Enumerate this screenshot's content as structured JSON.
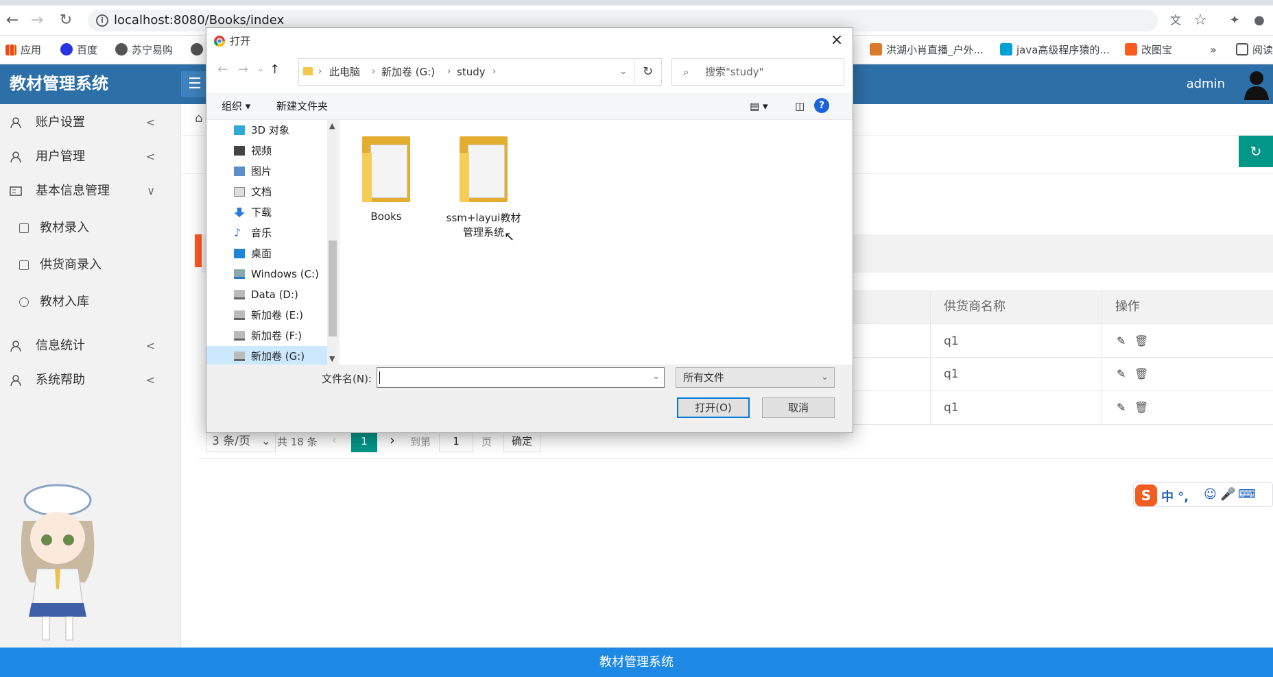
{
  "browser": {
    "url": "localhost:8080/Books/index",
    "bookmarks": [
      "应用",
      "百度",
      "苏宁易购",
      "洪湖小肖直播_户外...",
      "java高级程序猿的...",
      "改图宝",
      "阅读"
    ],
    "more": "»"
  },
  "app": {
    "title": "教材管理系统",
    "user": "admin",
    "footer": "教材管理系统"
  },
  "sidebar": {
    "items": [
      {
        "label": "账户设置",
        "arrow": "<"
      },
      {
        "label": "用户管理",
        "arrow": "<"
      },
      {
        "label": "基本信息管理",
        "arrow": "∨"
      },
      {
        "label": "信息统计",
        "arrow": "<"
      },
      {
        "label": "系统帮助",
        "arrow": "<"
      }
    ],
    "sub_items": [
      "教材录入",
      "供货商录入",
      "教材入库"
    ]
  },
  "table": {
    "headers": [
      "供货商名称",
      "操作"
    ],
    "rows": [
      {
        "supplier": "q1"
      },
      {
        "supplier": "q1"
      },
      {
        "supplier": "q1"
      }
    ]
  },
  "pagination": {
    "per_page": "3 条/页",
    "total": "共 18 条",
    "current": "1",
    "goto_label": "到第",
    "goto_value": "1",
    "page_unit": "页",
    "confirm": "确定"
  },
  "ime": {
    "label": "中 °,"
  },
  "dialog": {
    "title": "打开",
    "breadcrumb": [
      "此电脑",
      "新加卷 (G:)",
      "study"
    ],
    "search_placeholder": "搜索\"study\"",
    "toolbar": {
      "organize": "组织 ▾",
      "new_folder": "新建文件夹"
    },
    "nav_items": [
      "3D 对象",
      "视频",
      "图片",
      "文档",
      "下载",
      "音乐",
      "桌面",
      "Windows (C:)",
      "Data (D:)",
      "新加卷 (E:)",
      "新加卷 (F:)",
      "新加卷 (G:)"
    ],
    "folders": [
      {
        "name": "Books"
      },
      {
        "name": "ssm+layui教材管理系统"
      }
    ],
    "filename_label": "文件名(N):",
    "filename_value": "",
    "filetype": "所有文件",
    "open_button": "打开(O)",
    "cancel_button": "取消"
  }
}
